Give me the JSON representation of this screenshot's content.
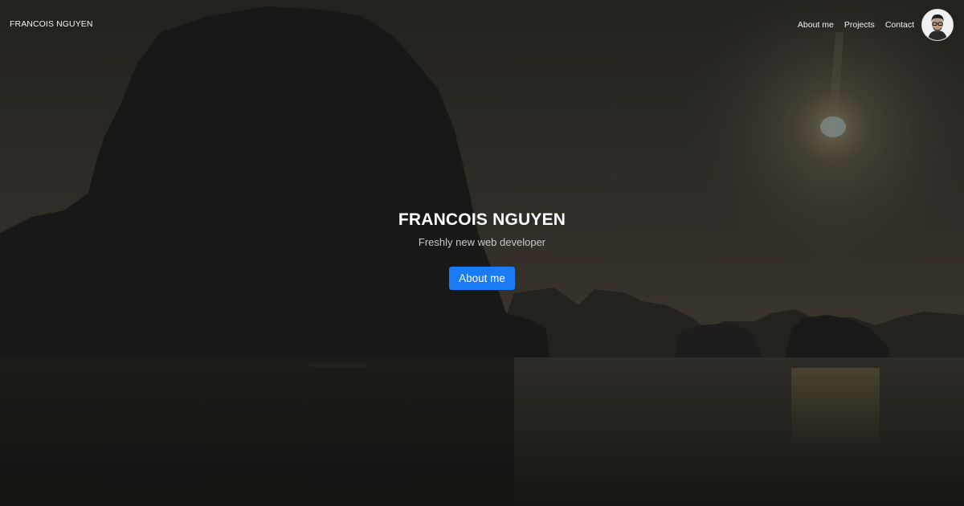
{
  "navbar": {
    "brand": "FRANCOIS NGUYEN",
    "links": [
      {
        "label": "About me"
      },
      {
        "label": "Projects"
      },
      {
        "label": "Contact"
      }
    ],
    "avatar_icon": "profile-photo-icon"
  },
  "hero": {
    "title": "FRANCOIS NGUYEN",
    "subtitle": "Freshly new web developer",
    "button_label": "About me",
    "button_color": "#1a7cf5",
    "background": "dark sunset seascape with limestone karst island silhouettes"
  }
}
